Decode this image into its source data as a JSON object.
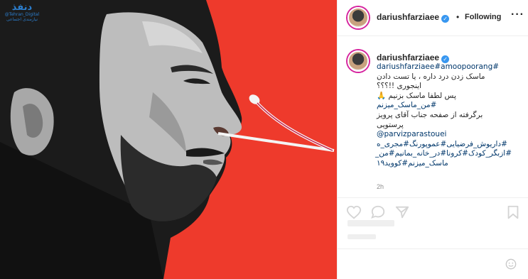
{
  "watermark": {
    "logo_text": "دنفذ",
    "handle": "@Tehran_Digital",
    "subtitle": "نیازمندی اجتماعی"
  },
  "photo": {
    "background_color": "#ee3a2c"
  },
  "post_header": {
    "username": "dariushfarziaee",
    "verified_glyph": "✓",
    "separator": "•",
    "follow_status": "Following",
    "more_glyph": "···"
  },
  "caption": {
    "username": "dariushfarziaee",
    "lines": [
      "#dariushfarziaee#amoopoorang",
      "ماسک زدن درد داره ، یا تست دادن",
      "اینجوری !!؟؟؟",
      "پس لطفا ماسک بزنیم 🙏",
      "#من_ماسک_میزنم",
      "برگرفته از صفحه جناب آقای پرویز",
      "پرستویی",
      "@parvizparastouei",
      "#داریوش_فرضیایی#عموپورنگ#مجری_ه",
      "#ازبگر_کودک#کرونا#در_خانه_بمانیم#من_",
      "ماسک_میزنم#کووید۱۹"
    ],
    "time": "2h"
  },
  "comment_box": {
    "placeholder": ""
  },
  "icons": {
    "like": "heart-icon",
    "comment": "comment-icon",
    "share": "share-icon",
    "save": "bookmark-icon",
    "emoji": "emoji-icon",
    "verified": "verified-badge-icon"
  },
  "colors": {
    "accent_link": "#00376b",
    "verified": "#3897f0",
    "placeholder_bar": "#efefef"
  }
}
